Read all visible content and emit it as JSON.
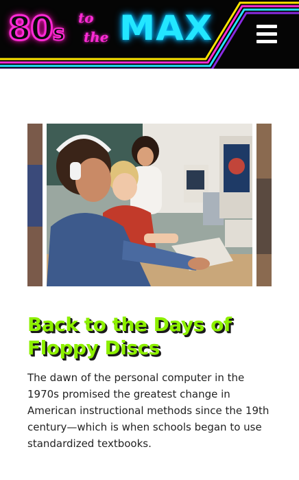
{
  "header": {
    "logo": {
      "part1": "80",
      "part1_small": "s",
      "to": "to",
      "the": "the",
      "part2": "MAX"
    },
    "menu_icon": "hamburger-menu-icon",
    "colors": {
      "background": "#050505",
      "pink": "#ff2bd6",
      "cyan": "#23e6ff",
      "yellow": "#ffe600",
      "purple": "#8a2be2"
    }
  },
  "article": {
    "title": "Back to the Days of Floppy Discs",
    "body": "The dawn of the personal computer in the 1970s promised the greatest change in American instructional methods since the 19th century—which is when schools began to use standardized textbooks.",
    "colors": {
      "title": "#8df000",
      "title_shadow": "#1a1a1a",
      "text": "#222222"
    }
  }
}
